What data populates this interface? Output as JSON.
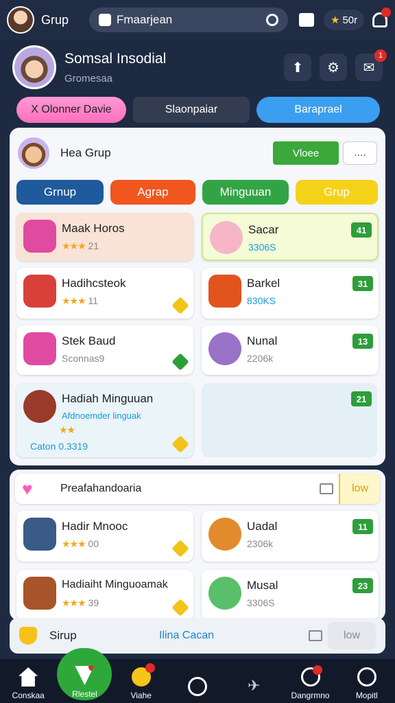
{
  "topbar": {
    "title": "Grup",
    "search_text": "Fmaarjean",
    "coins": "50r"
  },
  "profile": {
    "name": "Somsal Insodial",
    "subtitle": "Gromesaa",
    "notifications": "1"
  },
  "tabs": [
    "X Olonner Davie",
    "Slaonpaiar",
    "Baraprael"
  ],
  "panel": {
    "title": "Hea Grup",
    "vote_label": "Vloee",
    "more_label": "....",
    "chips": [
      "Grnup",
      "Agrap",
      "Minguuan",
      "Grup"
    ],
    "cards": [
      {
        "title": "Maak Horos",
        "stars": "★★★",
        "value": "21",
        "badge": "",
        "color": "#f9e2d6"
      },
      {
        "title": "Sacar",
        "stars": "",
        "value": "3306S",
        "badge": "41",
        "color": "#f4fbd6"
      },
      {
        "title": "Hadihcsteok",
        "stars": "★★★",
        "value": "11",
        "badge": "",
        "color": "#ffffff"
      },
      {
        "title": "Barkel",
        "stars": "",
        "value": "830KS",
        "badge": "31",
        "color": "#ffffff"
      },
      {
        "title": "Stek Baud",
        "stars": "",
        "value": "Sconnas9",
        "badge": "",
        "color": "#ffffff"
      },
      {
        "title": "Nunal",
        "stars": "",
        "value": "2206k",
        "badge": "13",
        "color": "#ffffff"
      }
    ],
    "weekly": {
      "title": "Hadiah Minguuan",
      "subtitle": "Afdnoemder linguak",
      "stars": "★★",
      "footer": "Caton 0.3319",
      "badge": "21"
    }
  },
  "section2": {
    "label": "Preafahandoaria",
    "low_label": "low",
    "cards": [
      {
        "title": "Hadir Mnooc",
        "stars": "★★★",
        "value": "00",
        "badge": ""
      },
      {
        "title": "Uadal",
        "stars": "",
        "value": "2306k",
        "badge": "11"
      },
      {
        "title": "Hadiaiht Minguoamak",
        "stars": "★★★",
        "value": "39",
        "badge": ""
      },
      {
        "title": "Musal",
        "stars": "",
        "value": "3306S",
        "badge": "23"
      }
    ]
  },
  "statusbar": {
    "label": "Sirup",
    "link": "Ilina Cacan",
    "low": "low"
  },
  "nav": [
    "Conskaa",
    "Rlestel",
    "Viahe",
    "",
    "",
    "Dangrmno",
    "Mopitl"
  ],
  "colors": {
    "accent_green": "#2fa83a",
    "bg": "#1e2a42"
  }
}
